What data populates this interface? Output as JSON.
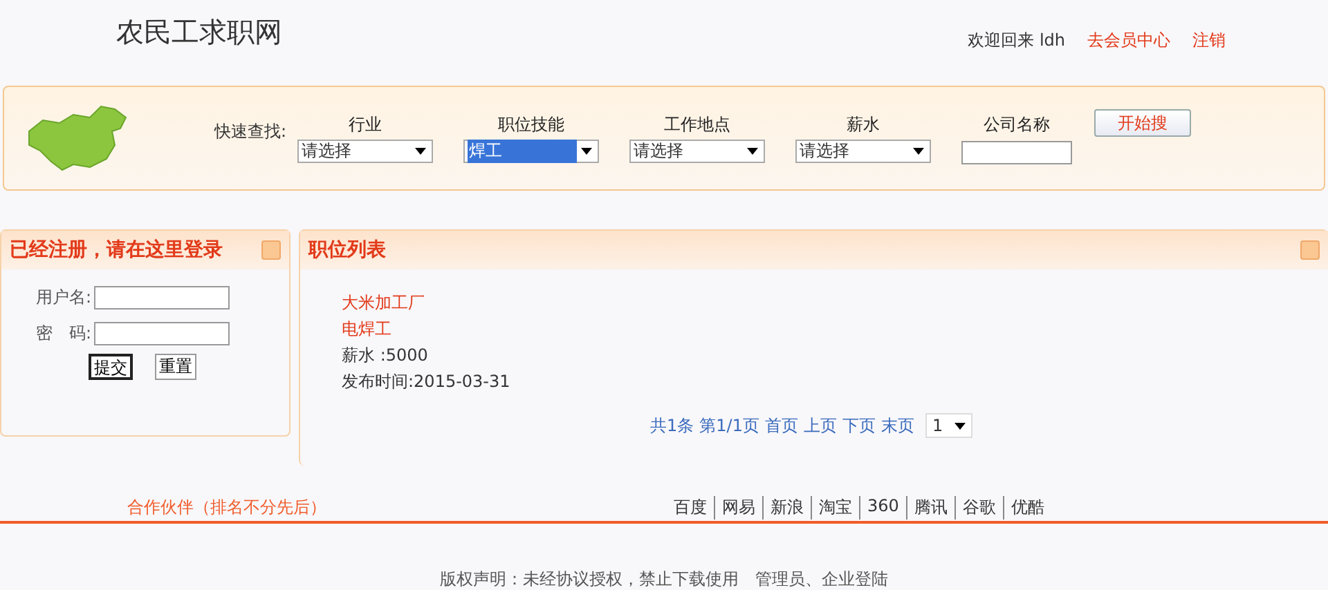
{
  "header": {
    "site_title": "农民工求职网",
    "welcome": "欢迎回来",
    "username": "ldh",
    "links": [
      "去会员中心",
      "注销"
    ]
  },
  "search": {
    "label": "快速查找:",
    "fields": [
      {
        "kind": "select",
        "label": "行业",
        "value": "请选择",
        "highlighted": false
      },
      {
        "kind": "select",
        "label": "职位技能",
        "value": "焊工",
        "highlighted": true
      },
      {
        "kind": "select",
        "label": "工作地点",
        "value": "请选择",
        "highlighted": false
      },
      {
        "kind": "select",
        "label": "薪水",
        "value": "请选择",
        "highlighted": false
      },
      {
        "kind": "text",
        "label": "公司名称"
      }
    ],
    "button": "开始搜"
  },
  "login": {
    "title": "已经注册，请在这里登录",
    "fields": [
      {
        "label": "用户名:"
      },
      {
        "label": "密　码:"
      }
    ],
    "buttons": [
      {
        "label": "提交",
        "focused": true
      },
      {
        "label": "重置",
        "focused": false
      }
    ]
  },
  "jobs": {
    "title": "职位列表",
    "items": [
      {
        "company": "大米加工厂",
        "position": "电焊工",
        "salary": "薪水  :5000",
        "date": "发布时间:2015-03-31"
      }
    ],
    "pager": {
      "links": [
        "共1条",
        "第1/1页",
        "首页",
        "上页",
        "下页",
        "末页"
      ],
      "page": "1"
    }
  },
  "partners": {
    "title": "合作伙伴（排名不分先后）",
    "links": [
      "百度",
      "网易",
      "新浪",
      "淘宝",
      "360",
      "腾讯",
      "谷歌",
      "优酷"
    ]
  },
  "footer": {
    "copyright": "版权声明：未经协议授权，禁止下载使用",
    "links": [
      "管理员",
      "企业登陆"
    ],
    "separator": "、"
  }
}
